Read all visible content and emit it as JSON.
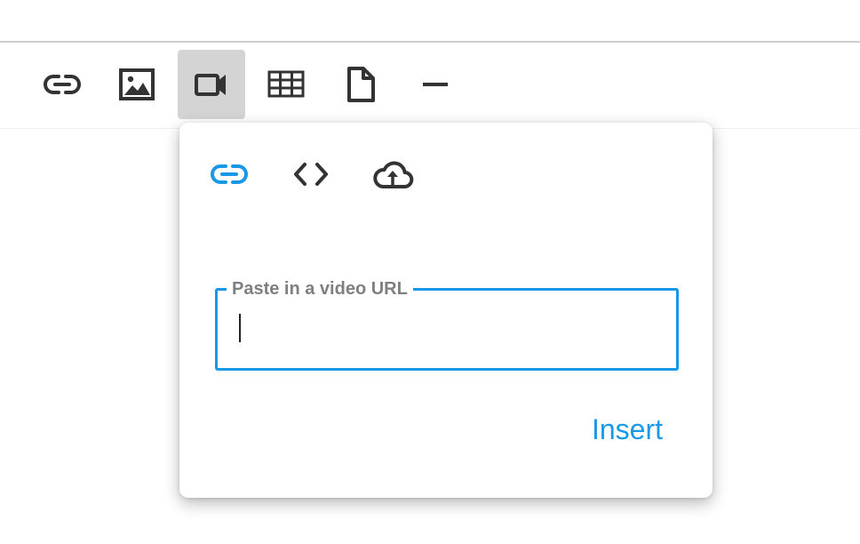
{
  "toolbar": {
    "items": [
      {
        "icon": "link-icon",
        "active": false
      },
      {
        "icon": "image-icon",
        "active": false
      },
      {
        "icon": "video-camera-icon",
        "active": true
      },
      {
        "icon": "table-icon",
        "active": false
      },
      {
        "icon": "file-icon",
        "active": false
      },
      {
        "icon": "horizontal-rule-icon",
        "active": false
      }
    ]
  },
  "video_popup": {
    "tabs": [
      {
        "icon": "link-icon",
        "selected": true
      },
      {
        "icon": "code-icon",
        "selected": false
      },
      {
        "icon": "cloud-upload-icon",
        "selected": false
      }
    ],
    "url_field": {
      "label": "Paste in a video URL",
      "value": "",
      "focused": true
    },
    "insert_label": "Insert"
  },
  "colors": {
    "accent": "#1a98e8",
    "icon": "#333333",
    "active_tool_bg": "#d4d4d4",
    "label": "#7f7f7f"
  }
}
